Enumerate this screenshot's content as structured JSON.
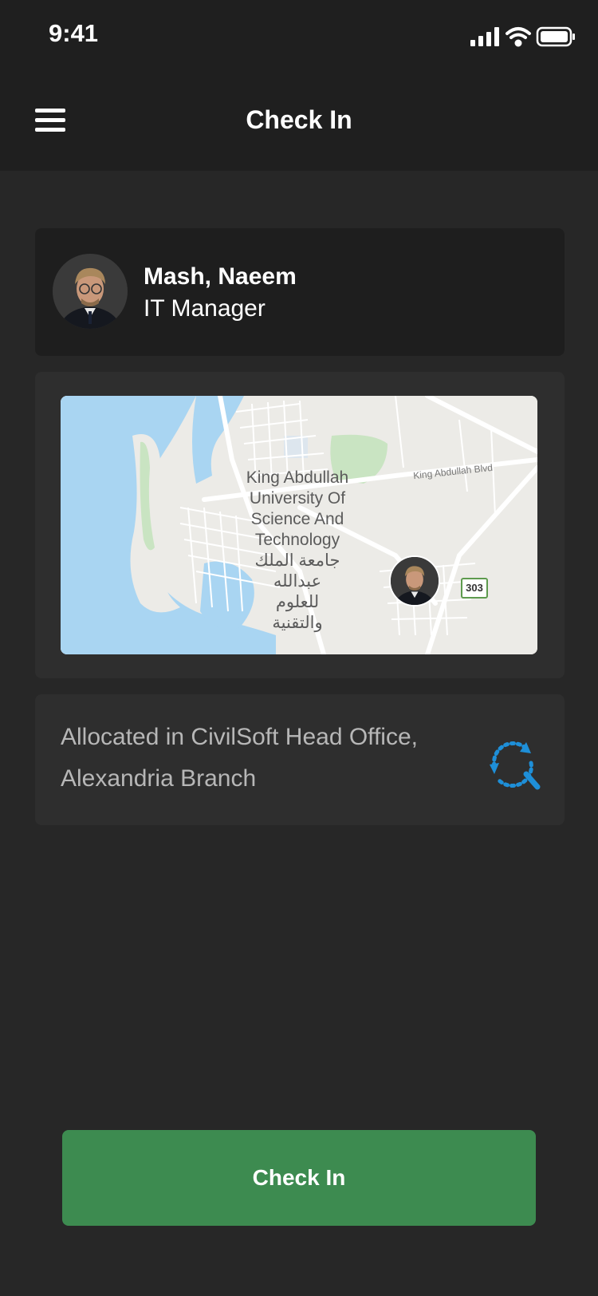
{
  "status_bar": {
    "time": "9:41",
    "icons": [
      "cellular-signal-icon",
      "wifi-icon",
      "battery-icon"
    ]
  },
  "nav": {
    "title": "Check In",
    "menu_icon": "hamburger-menu-icon"
  },
  "profile": {
    "name": "Mash, Naeem",
    "role": "IT Manager",
    "avatar_icon": "user-avatar"
  },
  "map": {
    "place_label": "King Abdullah\nUniversity Of\nScience And\nTechnology\nجامعة الملك\nعبدالله\nللعلوم\nوالتقنية",
    "road_label": "King Abdullah Blvd",
    "route_shield": "303",
    "marker_icon": "user-location-marker"
  },
  "allocation": {
    "text": "Allocated in CivilSoft Head Office, Alexandria Branch",
    "refresh_icon": "refresh-location-icon"
  },
  "actions": {
    "check_in_label": "Check In"
  },
  "colors": {
    "background": "#272727",
    "bar": "#1f1f1f",
    "card": "#2e2e2e",
    "primary_button": "#3d8b50",
    "accent_blue": "#1e8fd8"
  }
}
